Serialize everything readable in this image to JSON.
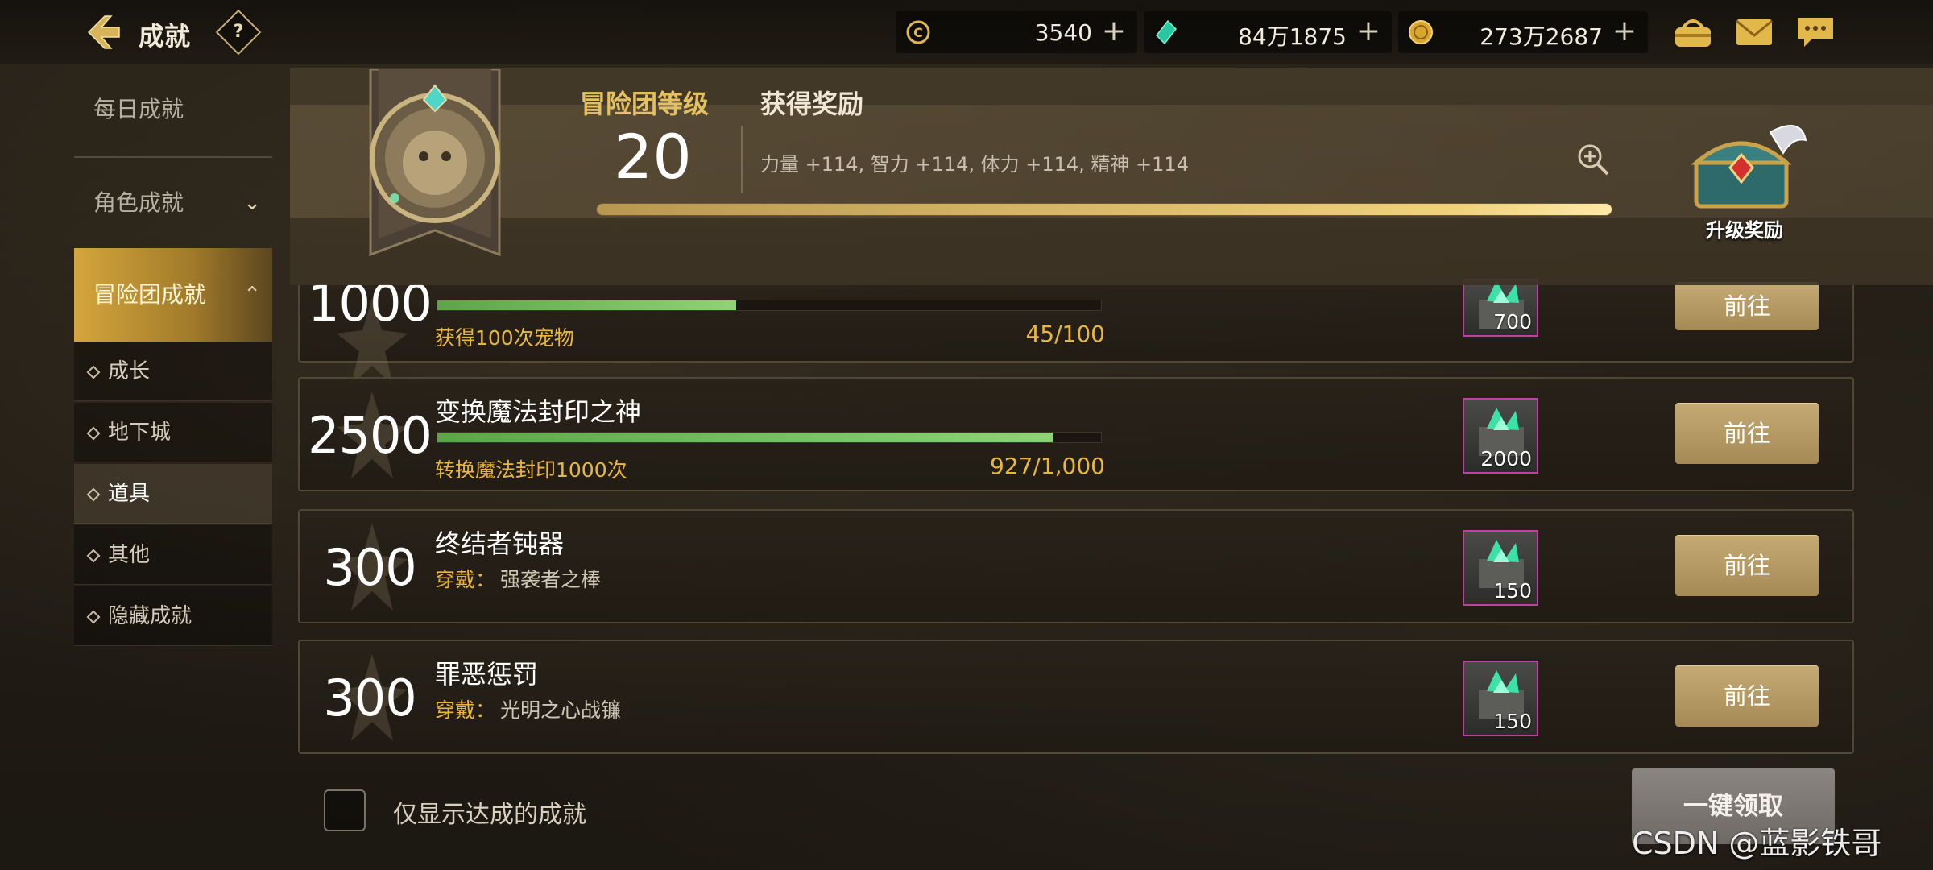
{
  "header": {
    "title": "成就",
    "help_label": "?"
  },
  "currencies": [
    {
      "icon": "coin-c-icon",
      "value": "3540",
      "plus": "+"
    },
    {
      "icon": "crystal-icon",
      "value": "84万1875",
      "plus": "+"
    },
    {
      "icon": "gold-coin-icon",
      "value": "273万2687",
      "plus": "+"
    }
  ],
  "sidebar": {
    "categories": [
      {
        "label": "每日成就"
      },
      {
        "label": "角色成就",
        "chevron": "⌄"
      },
      {
        "label": "冒险团成就",
        "chevron": "⌃"
      }
    ],
    "subitems": [
      {
        "label": "成长"
      },
      {
        "label": "地下城"
      },
      {
        "label": "道具"
      },
      {
        "label": "其他"
      },
      {
        "label": "隐藏成就"
      }
    ]
  },
  "level_panel": {
    "level_label": "冒险团等级",
    "level_value": "20",
    "reward_label": "获得奖励",
    "reward_stats": "力量 +114, 智力 +114, 体力 +114, 精神 +114",
    "progress": 1.0,
    "upgrade_label": "升级奖励"
  },
  "achievements": [
    {
      "points": "1000",
      "name": "",
      "condition": "获得100次宠物",
      "condition_value": "",
      "progress_text": "45/100",
      "progress": 0.45,
      "reward_qty": "700",
      "goto_label": "前往"
    },
    {
      "points": "2500",
      "name": "变换魔法封印之神",
      "condition": "转换魔法封印1000次",
      "condition_value": "",
      "progress_text": "927/1,000",
      "progress": 0.927,
      "reward_qty": "2000",
      "goto_label": "前往"
    },
    {
      "points": "300",
      "name": "终结者钝器",
      "condition": "穿戴：",
      "condition_value": "强袭者之棒",
      "progress_text": "",
      "progress": null,
      "reward_qty": "150",
      "goto_label": "前往"
    },
    {
      "points": "300",
      "name": "罪恶惩罚",
      "condition": "穿戴：",
      "condition_value": "光明之心战镰",
      "progress_text": "",
      "progress": null,
      "reward_qty": "150",
      "goto_label": "前往"
    }
  ],
  "footer": {
    "filter_label": "仅显示达成的成就",
    "claim_all_label": "一键领取"
  },
  "watermark": "CSDN @蓝影铁哥"
}
